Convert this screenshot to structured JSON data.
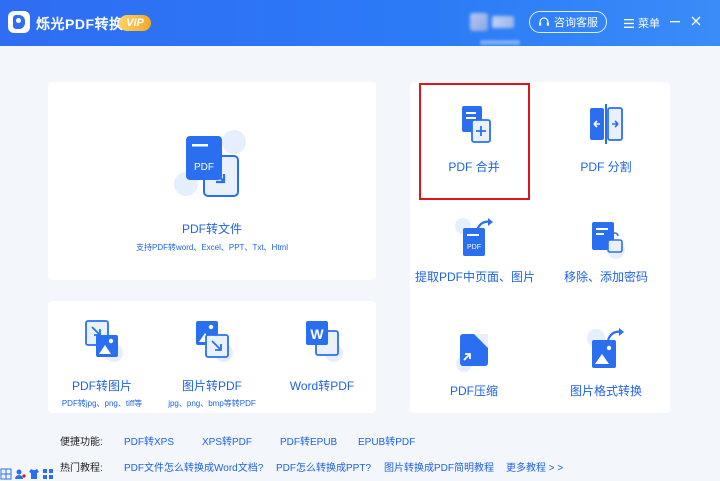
{
  "titlebar": {
    "app_title": "烁光PDF转换器",
    "vip_label": "VIP",
    "service_label": "咨询客服",
    "menu_label": "菜单",
    "bg_color": "#2f6df3"
  },
  "main_tools": {
    "pdf_to_file": {
      "label": "PDF转文件",
      "sub": "支持PDF转word、Excel、PPT、Txt、Html",
      "icon_text": "PDF"
    },
    "pdf_to_image": {
      "label": "PDF转图片",
      "sub": "PDF转jpg、png、tiff等"
    },
    "image_to_pdf": {
      "label": "图片转PDF",
      "sub": "jpg、png、bmp等转PDF"
    },
    "word_to_pdf": {
      "label": "Word转PDF",
      "icon_text": "W"
    }
  },
  "right_tools": {
    "merge": {
      "label": "PDF 合并"
    },
    "split": {
      "label": "PDF 分割"
    },
    "extract": {
      "label": "提取PDF中页面、图片",
      "icon_text": "PDF"
    },
    "password": {
      "label": "移除、添加密码"
    },
    "compress": {
      "label": "PDF压缩"
    },
    "image_convert": {
      "label": "图片格式转换"
    }
  },
  "shortcuts": {
    "label": "便捷功能:",
    "links": [
      "PDF转XPS",
      "XPS转PDF",
      "PDF转EPUB",
      "EPUB转PDF"
    ]
  },
  "tutorials": {
    "label": "热门教程:",
    "links": [
      "PDF文件怎么转换成Word文档?",
      "PDF怎么转换成PPT?",
      "图片转换成PDF简明教程",
      "更多教程 > >"
    ]
  },
  "colors": {
    "accent": "#1f63e8",
    "highlight": "#e0151c",
    "icon_light": "#dbe8fd"
  }
}
